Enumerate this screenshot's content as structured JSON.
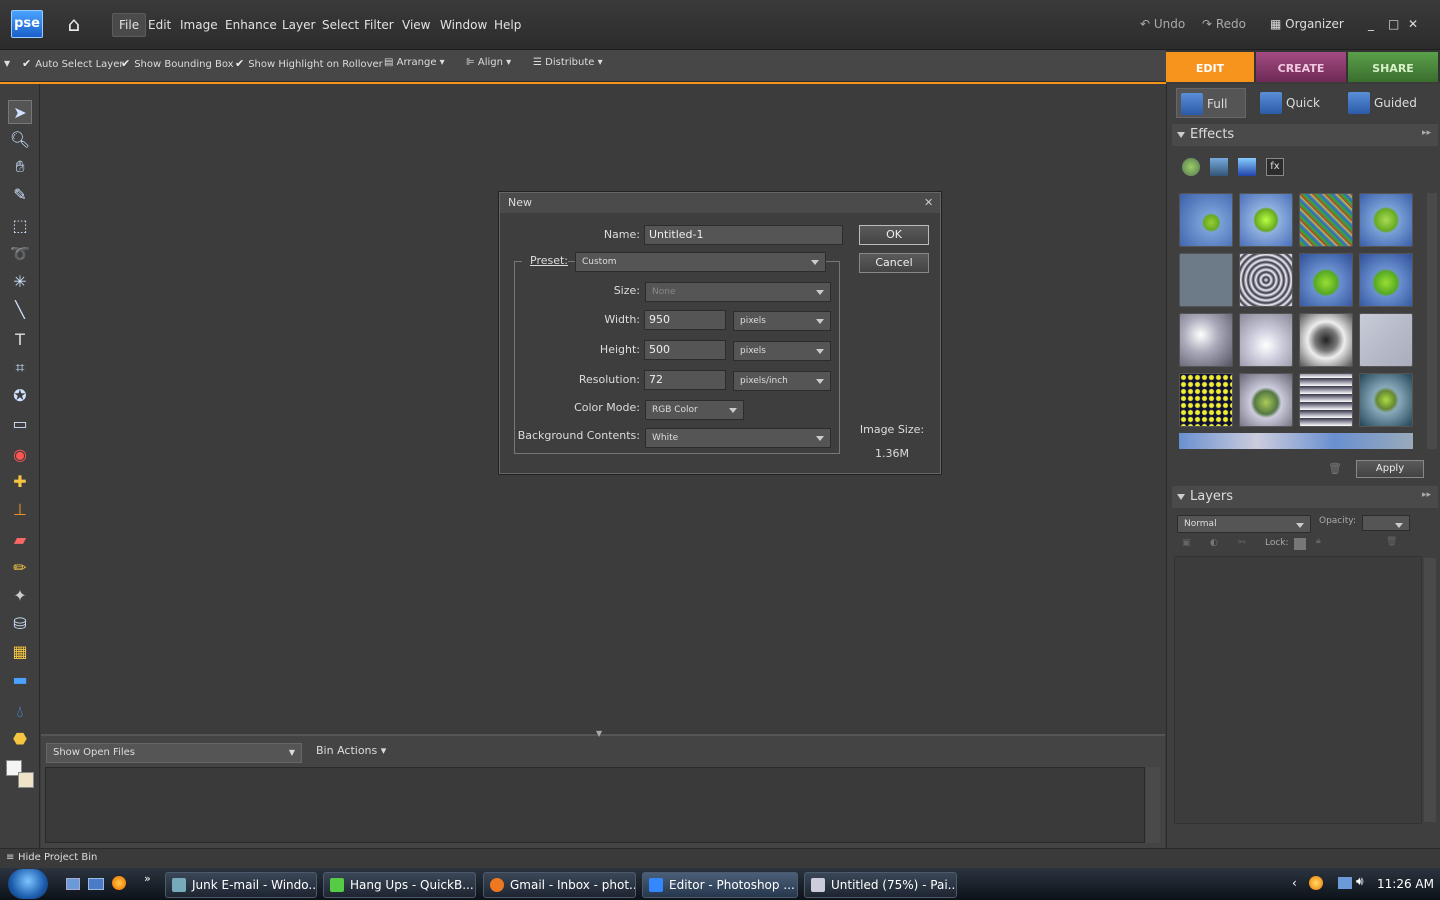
{
  "app": {
    "logo": "pse"
  },
  "menu": [
    "File",
    "Edit",
    "Image",
    "Enhance",
    "Layer",
    "Select",
    "Filter",
    "View",
    "Window",
    "Help"
  ],
  "topright": {
    "undo": "Undo",
    "redo": "Redo",
    "organizer": "Organizer"
  },
  "options": {
    "auto_select": "Auto Select Layer",
    "show_bbox": "Show Bounding Box",
    "show_highlight": "Show Highlight on Rollover",
    "arrange": "Arrange",
    "align": "Align",
    "distribute": "Distribute"
  },
  "tabs": {
    "edit": "EDIT",
    "create": "CREATE",
    "share": "SHARE"
  },
  "subtabs": {
    "full": "Full",
    "quick": "Quick",
    "guided": "Guided"
  },
  "effects": {
    "title": "Effects",
    "apply": "Apply"
  },
  "layers": {
    "title": "Layers",
    "mode": "Normal",
    "opacity_label": "Opacity:",
    "lock_label": "Lock:"
  },
  "bin": {
    "select": "Show Open Files",
    "actions": "Bin Actions",
    "hide": "Hide Project Bin"
  },
  "dialog": {
    "title": "New",
    "name_label": "Name:",
    "name_value": "Untitled-1",
    "preset_label": "Preset:",
    "preset_value": "Custom",
    "size_label": "Size:",
    "size_value": "None",
    "width_label": "Width:",
    "width_value": "950",
    "width_unit": "pixels",
    "height_label": "Height:",
    "height_value": "500",
    "height_unit": "pixels",
    "resolution_label": "Resolution:",
    "resolution_value": "72",
    "resolution_unit": "pixels/inch",
    "colormode_label": "Color Mode:",
    "colormode_value": "RGB Color",
    "bg_label": "Background Contents:",
    "bg_value": "White",
    "ok": "OK",
    "cancel": "Cancel",
    "imagesize_label": "Image Size:",
    "imagesize_value": "1.36M"
  },
  "taskbar": {
    "items": [
      "Junk E-mail - Windo...",
      "Hang Ups - QuickB...",
      "Gmail - Inbox - phot...",
      "Editor - Photoshop ...",
      "Untitled (75%) - Pai..."
    ],
    "clock": "11:26 AM"
  },
  "colors": {
    "accent": "#f7941d",
    "edit_tab": "#f7941d",
    "create_tab": "#8e3a6e",
    "share_tab": "#4e8a3a"
  }
}
